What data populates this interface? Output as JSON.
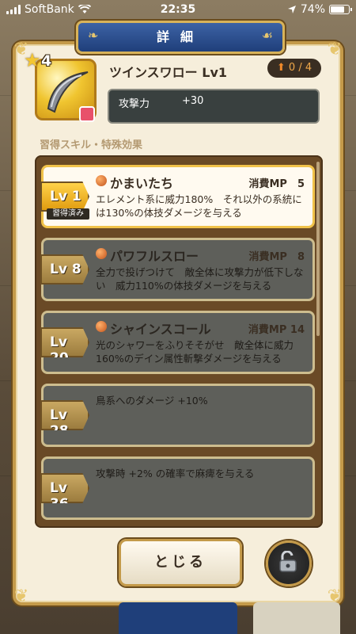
{
  "status": {
    "carrier": "SoftBank",
    "time": "22:35",
    "battery": "74%"
  },
  "dialog": {
    "title": "詳細"
  },
  "item": {
    "rank": "4",
    "name": "ツインスワロー Lv1",
    "limit_break": "0 / 4",
    "stat_label": "攻撃力",
    "stat_value": "+30",
    "icon": "boomerang-icon",
    "element_icon": "element-badge-icon"
  },
  "section_title": "習得スキル・特殊効果",
  "skills": [
    {
      "level": "Lv 1",
      "learned": "習得済み",
      "name": "かまいたち",
      "mp": "消費MP　5",
      "desc": "エレメント系に威力180%　それ以外の系統には130%の体技ダメージを与える"
    },
    {
      "level": "Lv 8",
      "name": "パワフルスロー",
      "mp": "消費MP　8",
      "desc": "全力で投げつけて　敵全体に攻撃力が低下しない　威力110%の体技ダメージを与える"
    },
    {
      "level": "Lv 20",
      "name": "シャインスコール",
      "mp": "消費MP 14",
      "desc": "光のシャワーをふりそそがせ　敵全体に威力160%のデイン属性斬撃ダメージを与える"
    },
    {
      "level": "Lv 28",
      "desc": "鳥系へのダメージ +10%"
    },
    {
      "level": "Lv 36",
      "desc": "攻撃時 +2% の確率で麻痺を与える"
    }
  ],
  "buttons": {
    "close": "とじる",
    "lock_icon": "unlock-icon"
  }
}
